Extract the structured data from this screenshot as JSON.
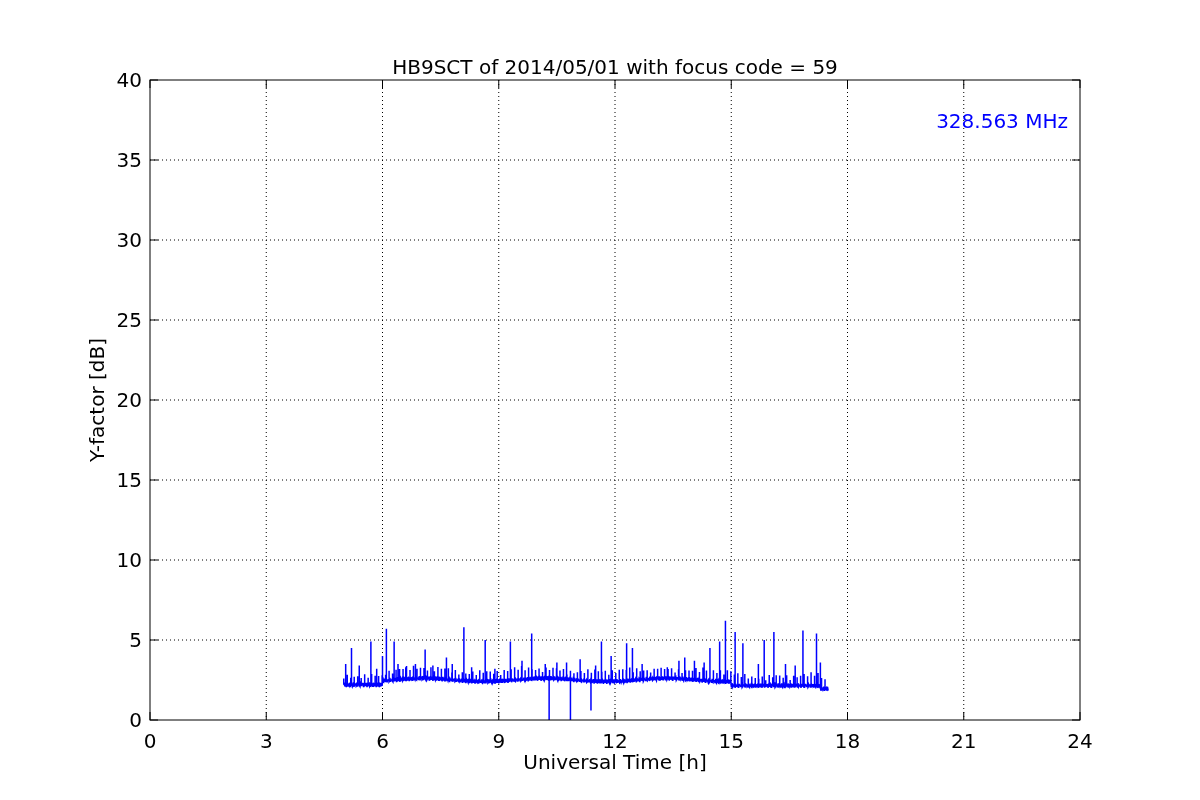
{
  "figure": {
    "title": "HB9SCT of 2014/05/01 with focus code = 59",
    "xlabel": "Universal Time [h]",
    "ylabel": "Y-factor [dB]",
    "xtick_labels": [
      "0",
      "3",
      "6",
      "9",
      "12",
      "15",
      "18",
      "21",
      "24"
    ],
    "ytick_labels": [
      "40",
      "35",
      "30",
      "25",
      "20",
      "15",
      "10",
      "5",
      "0"
    ],
    "annotation": "328.563 MHz"
  }
}
